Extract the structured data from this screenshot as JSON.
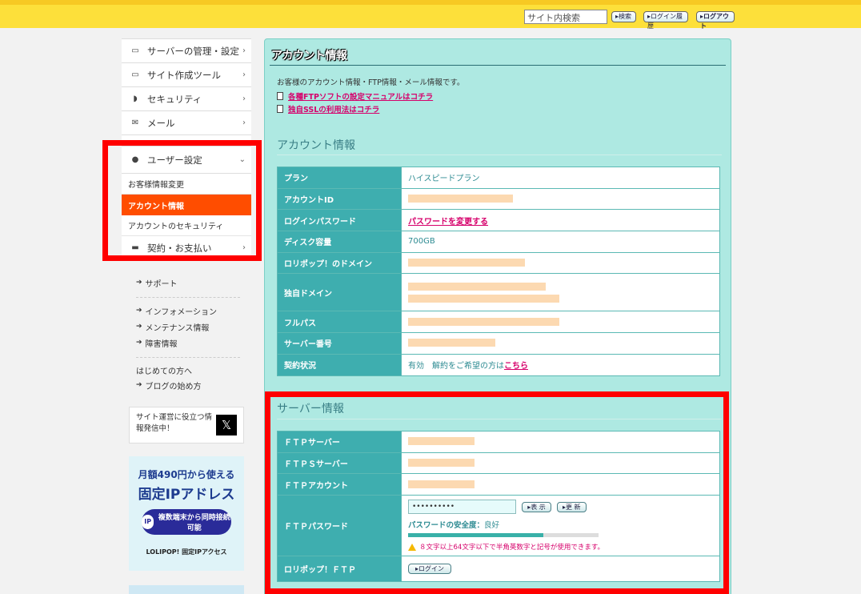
{
  "header": {
    "search_placeholder": "サイト内検索",
    "search_button": "検索",
    "history_button": "ログイン履歴",
    "logout_button": "ログアウト"
  },
  "sidebar": {
    "items": [
      {
        "label": "サーバーの管理・設定",
        "icon": "server-icon"
      },
      {
        "label": "サイト作成ツール",
        "icon": "laptop-icon"
      },
      {
        "label": "セキュリティ",
        "icon": "shield-icon"
      },
      {
        "label": "メール",
        "icon": "mail-icon"
      }
    ],
    "user_section": {
      "label": "ユーザー設定",
      "sub_items": [
        "お客様情報変更",
        "アカウント情報",
        "アカウントのセキュリティ"
      ]
    },
    "billing_label": "契約・お支払い",
    "links": {
      "support": "サポート",
      "info": "インフォメーション",
      "maintenance": "メンテナンス情報",
      "failure": "障害情報",
      "beginners": "はじめての方へ",
      "blog": "ブログの始め方"
    },
    "x_promo": "サイト運営に役立つ情報発信中！",
    "ad": {
      "line1": "月額490円から使える",
      "line2": "固定IPアドレス",
      "pill": "複数端末から同時接続可能",
      "brand": "LOLIPOP! 固定IPアクセス"
    }
  },
  "main": {
    "title": "アカウント情報",
    "intro": "お客様のアカウント情報・FTP情報・メール情報です。",
    "link1": "各種FTPソフトの設定マニュアルはコチラ",
    "link2": "独自SSLの利用法はコチラ",
    "account_section_title": "アカウント情報",
    "account_rows": [
      {
        "label": "プラン",
        "value": "ハイスピードプラン"
      },
      {
        "label": "アカウントID",
        "value": ""
      },
      {
        "label": "ログインパスワード",
        "value": "パスワードを変更する"
      },
      {
        "label": "ディスク容量",
        "value": "700GB"
      },
      {
        "label": "ロリポップ！のドメイン",
        "value": ""
      },
      {
        "label": "独自ドメイン",
        "value": ""
      },
      {
        "label": "フルパス",
        "value": ""
      },
      {
        "label": "サーバー番号",
        "value": ""
      },
      {
        "label": "契約状況",
        "value": "有効　解約をご希望の方は",
        "link": "こちら"
      }
    ],
    "server_section_title": "サーバー情報",
    "server_rows": {
      "ftp_server": "ＦＴＰサーバー",
      "ftps_server": "ＦＴＰＳサーバー",
      "ftp_account": "ＦＴＰアカウント",
      "ftp_password": "ＦＴＰパスワード",
      "lolipop_ftp": "ロリポップ！ＦＴＰ"
    },
    "password_value": "••••••••••",
    "show_button": "表 示",
    "update_button": "更 新",
    "strength_label": "パスワードの安全度：",
    "strength_value": "良好",
    "strength_fraction": 0.71,
    "warning": "８文字以上64文字以下で半角英数字と記号が使用できます。",
    "login_button": "ログイン"
  }
}
